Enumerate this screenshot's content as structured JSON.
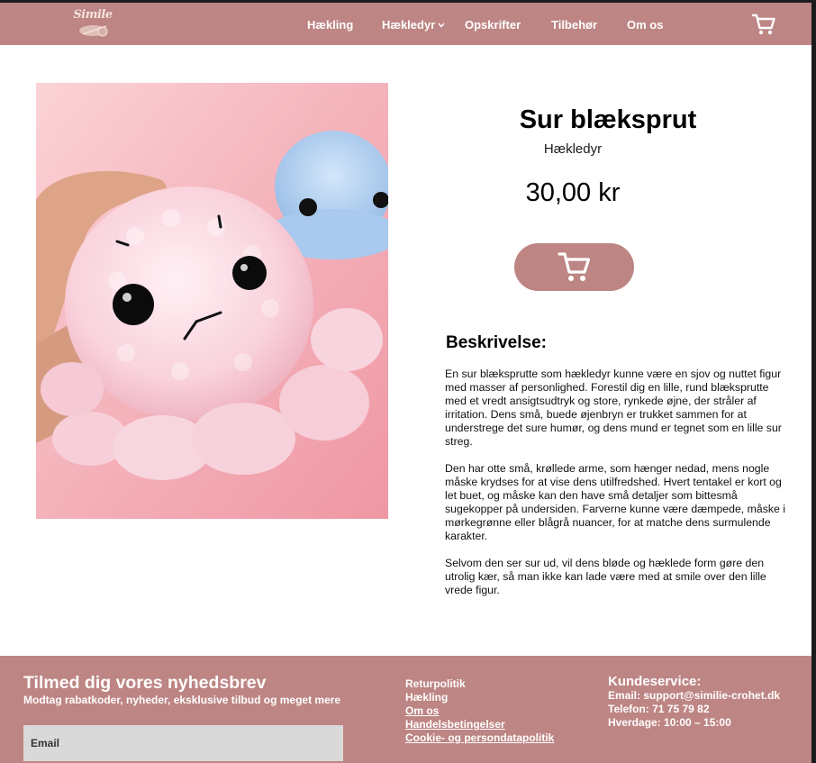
{
  "header": {
    "logo_text": "Simile",
    "nav": [
      {
        "label": "Hækling"
      },
      {
        "label": "Hækledyr"
      },
      {
        "label": "Opskrifter"
      },
      {
        "label": "Tilbehør"
      },
      {
        "label": "Om os"
      }
    ],
    "cart_icon": "cart-icon"
  },
  "product": {
    "title": "Sur blæksprut",
    "category": "Hækledyr",
    "price": "30,00 kr",
    "add_to_cart_icon": "cart-icon",
    "description_heading": "Beskrivelse:",
    "description": [
      "En sur blæksprutte som hækledyr kunne være en sjov og nuttet figur med masser af personlighed. Forestil dig en lille, rund blæksprutte med et vredt ansigtsudtryk og store, rynkede øjne, der stråler af irritation. Dens små, buede øjenbryn er trukket sammen for at understrege det sure humør, og dens mund er tegnet som en lille sur streg.",
      "Den har otte små, krøllede arme, som hænger nedad, mens nogle måske krydses for at vise dens utilfredshed. Hvert tentakel er kort og let buet, og måske kan den have små detaljer som bittesmå sugekopper på undersiden. Farverne kunne være dæmpede, måske i mørkegrønne eller blågrå nuancer, for at matche dens surmulende karakter.",
      "Selvom den ser sur ud, vil dens bløde og hæklede form gøre den utrolig kær, så man ikke kan lade være med at smile over den lille vrede figur."
    ]
  },
  "footer": {
    "newsletter_title": "Tilmed dig vores nyhedsbrev",
    "newsletter_subtitle": "Modtag rabatkoder, nyheder, eksklusive tilbud og meget mere",
    "email_placeholder": "Email",
    "links": [
      {
        "label": "Returpolitik"
      },
      {
        "label": "Hækling"
      },
      {
        "label": "Om os"
      },
      {
        "label": "Handelsbetingelser"
      },
      {
        "label": "Cookie- og persondatapolitik"
      }
    ],
    "customer_service": {
      "title": "Kundeservice:",
      "email": "Email:  support@similie-crohet.dk",
      "phone": "Telefon: 71 75 79 82",
      "hours": "Hverdage: 10:00 – 15:00"
    }
  },
  "colors": {
    "brand": "#bd8583",
    "background": "#ffffff",
    "input": "#d9d9d9"
  }
}
